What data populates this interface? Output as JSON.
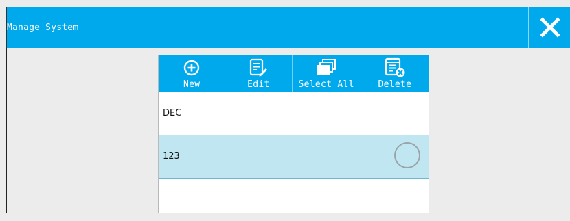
{
  "window": {
    "title": "Manage System",
    "close_icon": "close-icon",
    "accent_color": "#00a9ec"
  },
  "toolbar": {
    "items": [
      {
        "label": "New",
        "icon": "add-circle-icon"
      },
      {
        "label": "Edit",
        "icon": "edit-document-icon"
      },
      {
        "label": "Select All",
        "icon": "stacked-pages-icon"
      },
      {
        "label": "Delete",
        "icon": "delete-document-icon"
      }
    ]
  },
  "list": {
    "rows": [
      {
        "text": "DEC",
        "selected": false
      },
      {
        "text": "123",
        "selected": true
      },
      {
        "text": "",
        "selected": false
      }
    ],
    "selected_color": "#c0e7f1"
  }
}
